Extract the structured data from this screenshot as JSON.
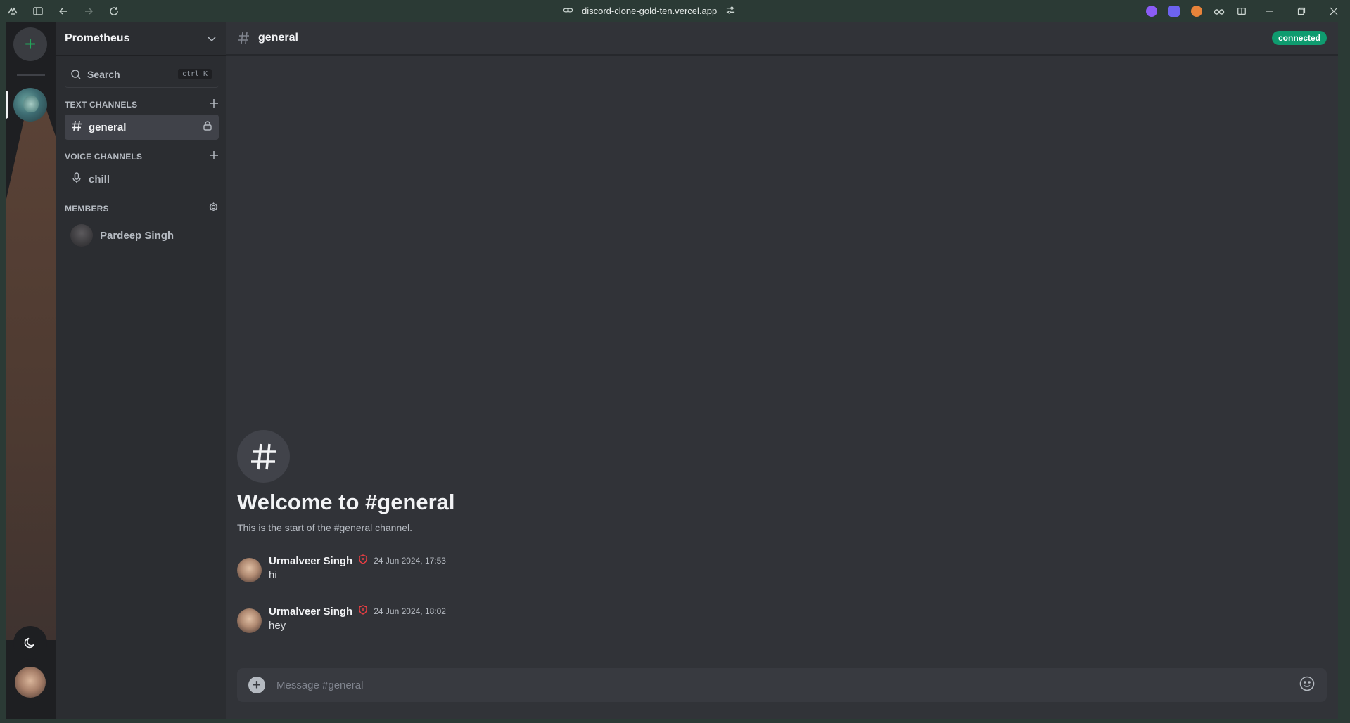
{
  "browser": {
    "url": "discord-clone-gold-ten.vercel.app",
    "extension_colors": [
      "#8b5cf6",
      "#6d63f0",
      "#e8833a",
      "#cfd8d4"
    ]
  },
  "server": {
    "name": "Prometheus"
  },
  "search": {
    "label": "Search",
    "shortcut": "ctrl K"
  },
  "sections": {
    "text_channels": "TEXT CHANNELS",
    "voice_channels": "VOICE CHANNELS",
    "members": "MEMBERS"
  },
  "channels": {
    "text": [
      {
        "name": "general"
      }
    ],
    "voice": [
      {
        "name": "chill"
      }
    ]
  },
  "members": [
    {
      "name": "Pardeep Singh"
    }
  ],
  "header": {
    "channel": "general",
    "status": "connected"
  },
  "welcome": {
    "title": "Welcome to #general",
    "subtitle": "This is the start of the #general channel."
  },
  "messages": [
    {
      "author": "Urmalveer Singh",
      "time": "24 Jun 2024, 17:53",
      "text": "hi"
    },
    {
      "author": "Urmalveer Singh",
      "time": "24 Jun 2024, 18:02",
      "text": "hey"
    }
  ],
  "composer": {
    "placeholder": "Message #general"
  },
  "colors": {
    "accent_green": "#23a55a",
    "status_green": "#0f9b6f",
    "shield_red": "#f23f43"
  }
}
